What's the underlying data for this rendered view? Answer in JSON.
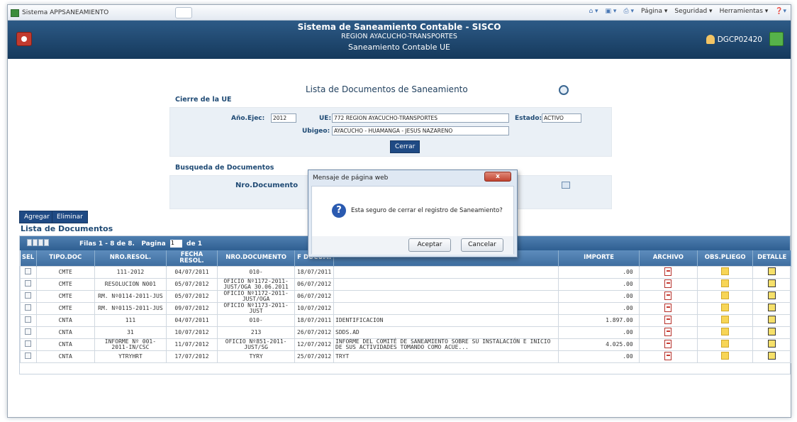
{
  "browser": {
    "tab_title": "Sistema APPSANEAMIENTO",
    "menu": [
      "Página ▾",
      "Seguridad ▾",
      "Herramientas ▾"
    ]
  },
  "header": {
    "title": "Sistema de Saneamiento Contable - SISCO",
    "subtitle": "REGION AYACUCHO-TRANSPORTES",
    "subtitle2": "Saneamiento Contable UE",
    "user": "DGCP02420"
  },
  "page": {
    "title": "Lista de Documentos de Saneamiento"
  },
  "cierre": {
    "section": "Cierre de la UE",
    "anio_label": "Año.Ejec:",
    "anio_value": "2012",
    "ue_label": "UE:",
    "ue_value": "772 REGION AYACUCHO-TRANSPORTES",
    "estado_label": "Estado:",
    "estado_value": "ACTIVO",
    "ubigeo_label": "Ubigeo:",
    "ubigeo_value": "AYACUCHO - HUAMANGA - JESUS NAZARENO",
    "close_button": "Cerrar"
  },
  "busqueda": {
    "section": "Busqueda de Documentos",
    "nro_label": "Nro.Documento"
  },
  "actions": {
    "add": "Agregar",
    "delete": "Eliminar"
  },
  "list": {
    "title": "Lista de Documentos",
    "pager_prefix": "Filas 1 - 8 de 8.",
    "pager_page_label": "Pagina",
    "page_value": "1",
    "pager_suffix": "de 1"
  },
  "table": {
    "headers": [
      "SEL",
      "TIPO.DOC",
      "NRO.RESOL.",
      "FECHA RESOL.",
      "NRO.DOCUMENTO",
      "F DOCUM.",
      "",
      "IMPORTE",
      "ARCHIVO",
      "OBS.PLIEGO",
      "DETALLE"
    ],
    "rows": [
      {
        "tipo": "CMTE",
        "resol": "111-2012",
        "fecha": "04/07/2011",
        "nro": "010-",
        "fdoc": "18/07/2011",
        "desc": "",
        "importe": ".00"
      },
      {
        "tipo": "CMTE",
        "resol": "RESOLUCION N001",
        "fecha": "05/07/2012",
        "nro": "OFICIO Nº1172-2011-JUST/OGA 30.06.2011",
        "fdoc": "06/07/2012",
        "desc": "",
        "importe": ".00"
      },
      {
        "tipo": "CMTE",
        "resol": "RM. Nº0114-2011-JUS",
        "fecha": "05/07/2012",
        "nro": "OFICIO Nº1172-2011-JUST/OGA",
        "fdoc": "06/07/2012",
        "desc": "",
        "importe": ".00"
      },
      {
        "tipo": "CMTE",
        "resol": "RM. Nº0115-2011-JUS",
        "fecha": "09/07/2012",
        "nro": "OFICIO Nº1173-2011-JUST",
        "fdoc": "10/07/2012",
        "desc": "",
        "importe": ".00"
      },
      {
        "tipo": "CNTA",
        "resol": "111",
        "fecha": "04/07/2011",
        "nro": "010-",
        "fdoc": "18/07/2011",
        "desc": "IDENTIFICACION",
        "importe": "1.897.00"
      },
      {
        "tipo": "CNTA",
        "resol": "31",
        "fecha": "10/07/2012",
        "nro": "213",
        "fdoc": "26/07/2012",
        "desc": "SDDS.AD",
        "importe": ".00"
      },
      {
        "tipo": "CNTA",
        "resol": "INFORME Nº 001-2011-IN/CSC",
        "fecha": "11/07/2012",
        "nro": "OFICIO Nº851-2011-JUST/SG",
        "fdoc": "12/07/2012",
        "desc": "INFORME DEL COMITÉ DE SANEAMIENTO SOBRE SU INSTALACIÓN E INICIO DE SUS ACTIVIDADES TOMANDO COMO ACUE...",
        "importe": "4.025.00"
      },
      {
        "tipo": "CNTA",
        "resol": "YTRYHRT",
        "fecha": "17/07/2012",
        "nro": "TYRY",
        "fdoc": "25/07/2012",
        "desc": "TRYT",
        "importe": ".00"
      }
    ]
  },
  "dialog": {
    "title": "Mensaje de página web",
    "message": "Esta seguro de cerrar el registro de Saneamiento?",
    "accept": "Aceptar",
    "cancel": "Cancelar",
    "close": "x"
  }
}
